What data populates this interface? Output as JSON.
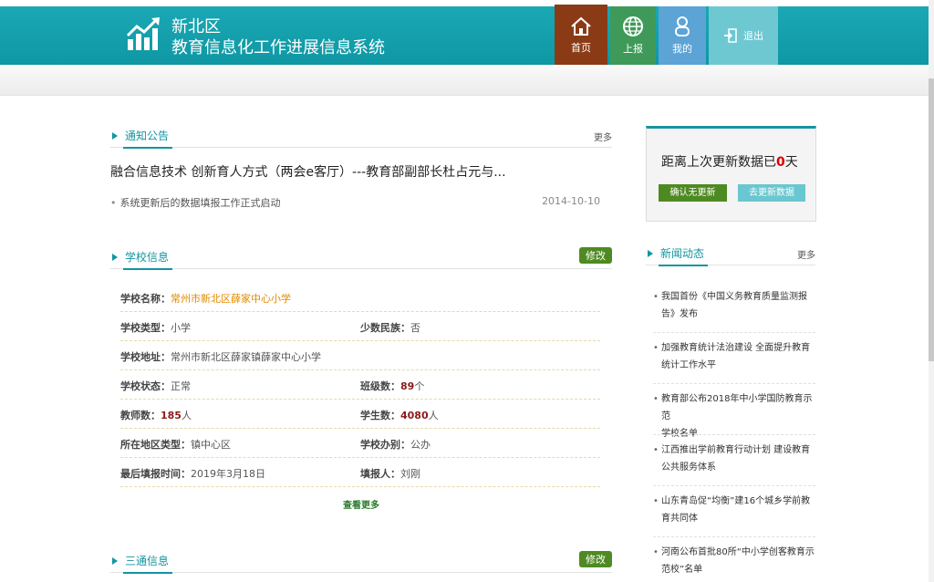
{
  "header": {
    "title_line1": "新北区",
    "title_line2": "教育信息化工作进展信息系统",
    "nav": {
      "home": "首页",
      "report": "上报",
      "mine": "我的",
      "exit": "退出"
    }
  },
  "notices": {
    "title": "通知公告",
    "more": "更多",
    "headline": "融合信息技术 创新育人方式（两会e客厅）---教育部副部长杜占元与...",
    "items": [
      {
        "text": "系统更新后的数据填报工作正式启动",
        "date": "2014-10-10"
      }
    ]
  },
  "school_info": {
    "title": "学校信息",
    "edit": "修改",
    "rows": [
      {
        "k1": "学校名称：",
        "v1": "常州市新北区薛家中心小学"
      },
      {
        "k1": "学校类型：",
        "v1": "小学",
        "k2": "少数民族：",
        "v2": "否"
      },
      {
        "k1": "学校地址：",
        "v1": "常州市新北区薛家镇薛家中心小学"
      },
      {
        "k1": "学校状态：",
        "v1": "正常",
        "k2": "班级数：",
        "v2": "89",
        "u2": "个"
      },
      {
        "k1": "教师数：",
        "v1": "185",
        "u1": "人",
        "k2": "学生数：",
        "v2": "4080",
        "u2": "人"
      },
      {
        "k1": "所在地区类型：",
        "v1": "镇中心区",
        "k2": "学校办别：",
        "v2": "公办"
      },
      {
        "k1": "最后填报时间：",
        "v1": "2019年3月18日",
        "k2": "填报人：",
        "v2": "刘刚"
      }
    ],
    "view_more": "查看更多"
  },
  "santong": {
    "title": "三通信息",
    "edit": "修改"
  },
  "update_panel": {
    "text_before": "距离上次更新数据已",
    "days": "0",
    "text_after": "天",
    "confirm": "确认无更新",
    "go_update": "去更新数据"
  },
  "news": {
    "title": "新闻动态",
    "more": "更多",
    "items": [
      {
        "line1": "我国首份《中国义务教育质量监测报",
        "line2": "告》发布"
      },
      {
        "line1": "加强教育统计法治建设 全面提升教育",
        "line2": "统计工作水平"
      },
      {
        "line1": "教育部公布2018年中小学国防教育示范",
        "line2": "学校名单"
      },
      {
        "line1": "江西推出学前教育行动计划 建设教育",
        "line2": "公共服务体系"
      },
      {
        "line1": "山东青岛促“均衡”建16个城乡学前教",
        "line2": "育共同体"
      },
      {
        "line1": "河南公布首批80所“中小学创客教育示",
        "line2": "范校”名单"
      }
    ]
  }
}
